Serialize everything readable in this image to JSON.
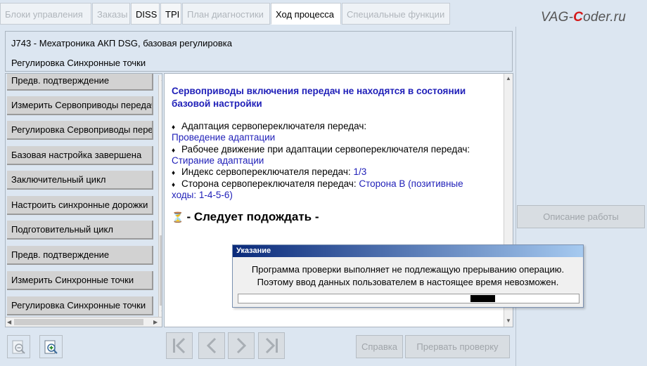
{
  "tabs": [
    {
      "label": "Блоки управления",
      "state": "disabled"
    },
    {
      "label": "Заказы",
      "state": "disabled"
    },
    {
      "label": "DISS",
      "state": "enabled"
    },
    {
      "label": "TPI",
      "state": "enabled"
    },
    {
      "label": "План диагностики",
      "state": "disabled"
    },
    {
      "label": "Ход процесса",
      "state": "active"
    },
    {
      "label": "Специальные функции",
      "state": "disabled"
    }
  ],
  "brand": {
    "pre": "VAG-",
    "c": "C",
    "post": "oder.ru"
  },
  "header": {
    "line1": "J743 - Мехатроника АКП DSG, базовая регулировка",
    "line2": "Регулировка Синхронные точки"
  },
  "steps": [
    "Предв. подтверждение",
    "Измерить Сервоприводы передач",
    "Регулировка Сервоприводы передач",
    "Базовая настройка завершена",
    "Заключительный цикл",
    "Настроить синхронные дорожки",
    "Подготовительный цикл",
    "Предв. подтверждение",
    "Измерить Синхронные точки",
    "Регулировка Синхронные точки"
  ],
  "content": {
    "title": "Сервоприводы включения передач не находятся в состоянии базовой настройки",
    "item1_label": "Адаптация сервопереключателя передач:",
    "item1_value": "Проведение адаптации",
    "item2_label": "Рабочее движение при адаптации сервопереключателя передач:",
    "item2_value": "Стирание адаптации",
    "item3_label": "Индекс сервопереключателя передач:",
    "item3_value": "1/3",
    "item4_label": "Сторона сервопереключателя передач:",
    "item4_value_a": "Сторона В (позитивные",
    "item4_value_b": "ходы: 1-4-5-6)",
    "wait": "- Следует подождать -"
  },
  "dialog": {
    "title": "Указание",
    "line1": "Программа проверки выполняет не подлежащую прерыванию операцию.",
    "line2": "Поэтому ввод данных пользователем в настоящее время невозможен."
  },
  "buttons": {
    "help": "Справка",
    "abort": "Прервать проверку",
    "description": "Описание работы"
  },
  "icons": {
    "zoom_out": "zoom-out-icon",
    "zoom_in": "zoom-in-icon",
    "first": "first-page-icon",
    "prev": "previous-page-icon",
    "next": "next-page-icon",
    "last": "last-page-icon",
    "hourglass": "hourglass-icon"
  },
  "colors": {
    "link": "#1f1fb8",
    "panel_bg": "#dce6f1",
    "brand_accent": "#d41919"
  }
}
